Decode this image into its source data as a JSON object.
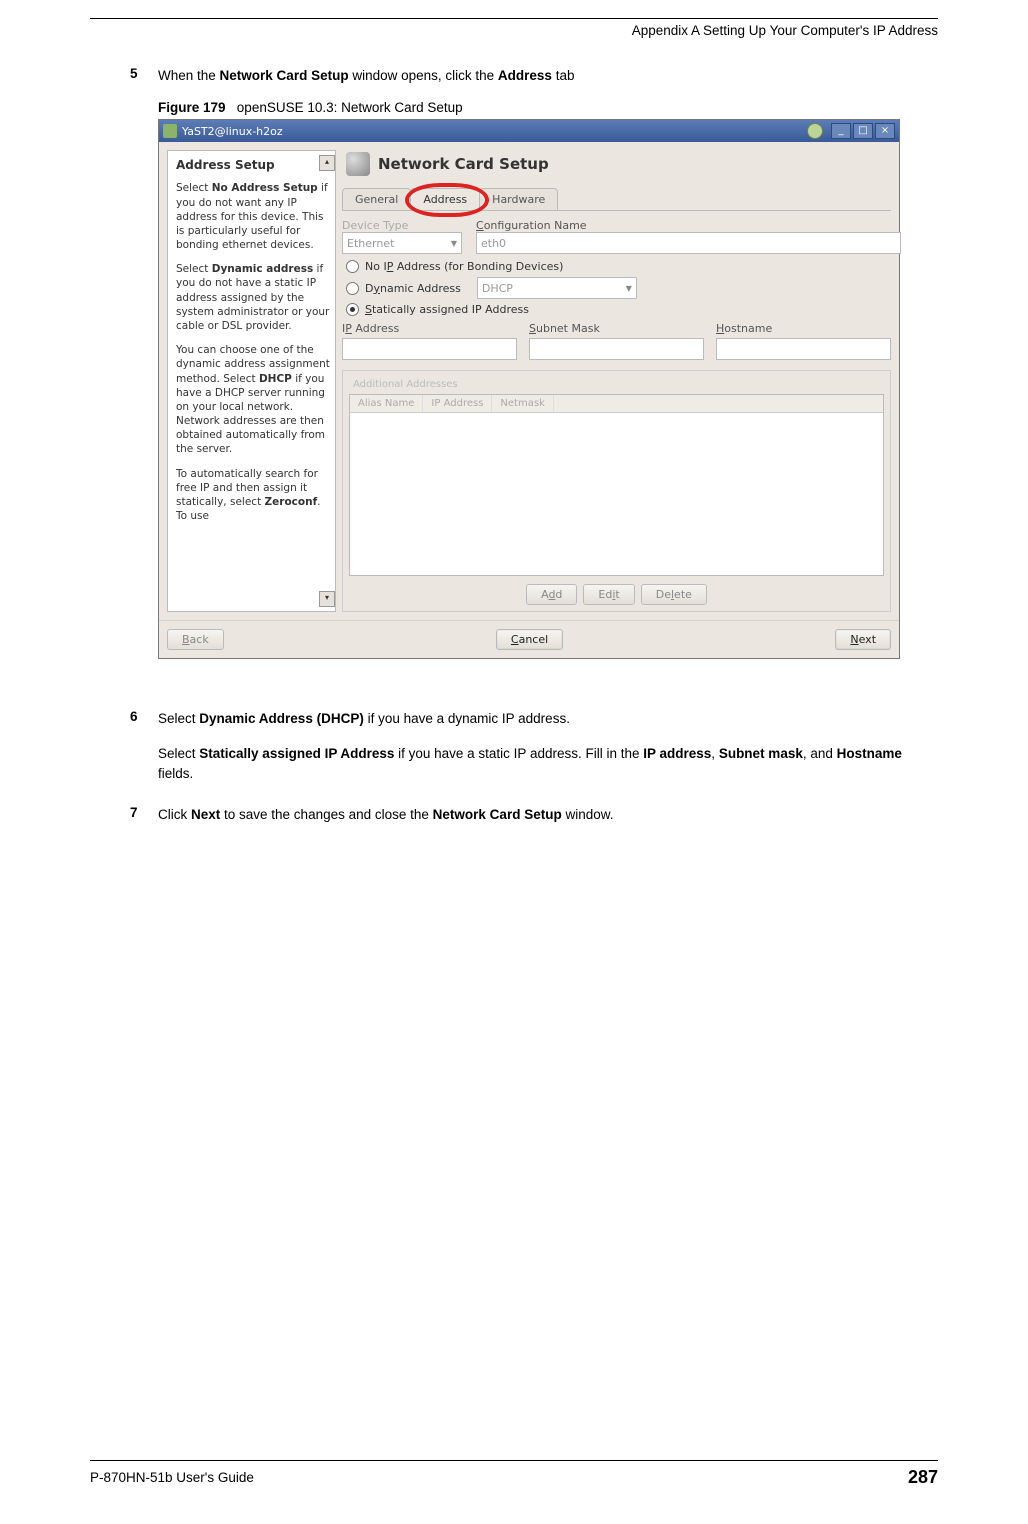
{
  "header": {
    "appendix": "Appendix A Setting Up Your Computer's IP Address"
  },
  "steps": {
    "s5": {
      "num": "5",
      "text_before": "When the ",
      "bold1": "Network Card Setup",
      "text_mid": " window opens, click the ",
      "bold2": "Address",
      "text_after": " tab"
    },
    "s6": {
      "num": "6",
      "line1_a": "Select ",
      "line1_b": "Dynamic Address (DHCP)",
      "line1_c": " if you have a dynamic IP address.",
      "line2_a": "Select ",
      "line2_b": "Statically assigned IP Address",
      "line2_c": " if you have a static IP address. Fill in the ",
      "line2_d": "IP address",
      "line2_e": ", ",
      "line2_f": "Subnet mask",
      "line2_g": ", and ",
      "line2_h": "Hostname",
      "line2_i": " fields."
    },
    "s7": {
      "num": "7",
      "a": "Click ",
      "b": "Next",
      "c": " to save the changes and close the ",
      "d": "Network Card Setup",
      "e": " window."
    }
  },
  "figure": {
    "label": "Figure 179",
    "caption": "openSUSE 10.3: Network Card Setup"
  },
  "window": {
    "title": "YaST2@linux-h2oz",
    "help": {
      "title": "Address Setup",
      "p1a": "Select ",
      "p1b": "No Address Setup",
      "p1c": " if you do not want any IP address for this device. This is particularly useful for bonding ethernet devices.",
      "p2a": "Select ",
      "p2b": "Dynamic address",
      "p2c": " if you do not have a static IP address assigned by the system administrator or your cable or DSL provider.",
      "p3a": "You can choose one of the dynamic address assignment method. Select ",
      "p3b": "DHCP",
      "p3c": " if you have a DHCP server running on your local network. Network addresses are then obtained automatically from the server.",
      "p4a": "To automatically search for free IP and then assign it statically, select ",
      "p4b": "Zeroconf",
      "p4c": ". To use"
    },
    "main_title": "Network Card Setup",
    "tabs": {
      "general": "General",
      "address": "Address",
      "hardware": "Hardware"
    },
    "labels": {
      "device_type": "Device Type",
      "config_name": "Configuration Name",
      "eth_value": "Ethernet",
      "eth0": "eth0",
      "radio_noip_pre": "No I",
      "radio_noip_u": "P",
      "radio_noip_post": " Address (for Bonding Devices)",
      "radio_dyn_pre": "D",
      "radio_dyn_u": "y",
      "radio_dyn_post": "namic Address",
      "dhcp": "DHCP",
      "radio_static_pre": "",
      "radio_static_u": "S",
      "radio_static_post": "tatically assigned IP Address",
      "ip_pre": "I",
      "ip_u": "P",
      "ip_post": " Address",
      "subnet_pre": "",
      "subnet_u": "S",
      "subnet_post": "ubnet Mask",
      "host_pre": "",
      "host_u": "H",
      "host_post": "ostname",
      "additional": "Additional Addresses",
      "th_alias": "Alias Name",
      "th_ip": "IP Address",
      "th_mask": "Netmask",
      "add_pre": "A",
      "add_u": "d",
      "add_post": "d",
      "edit_pre": "Ed",
      "edit_u": "i",
      "edit_post": "t",
      "del_pre": "De",
      "del_u": "l",
      "del_post": "ete",
      "back_pre": "",
      "back_u": "B",
      "back_post": "ack",
      "cancel_pre": "",
      "cancel_u": "C",
      "cancel_post": "ancel",
      "next_pre": "",
      "next_u": "N",
      "next_post": "ext"
    }
  },
  "footer": {
    "guide": "P-870HN-51b User's Guide",
    "page": "287"
  }
}
